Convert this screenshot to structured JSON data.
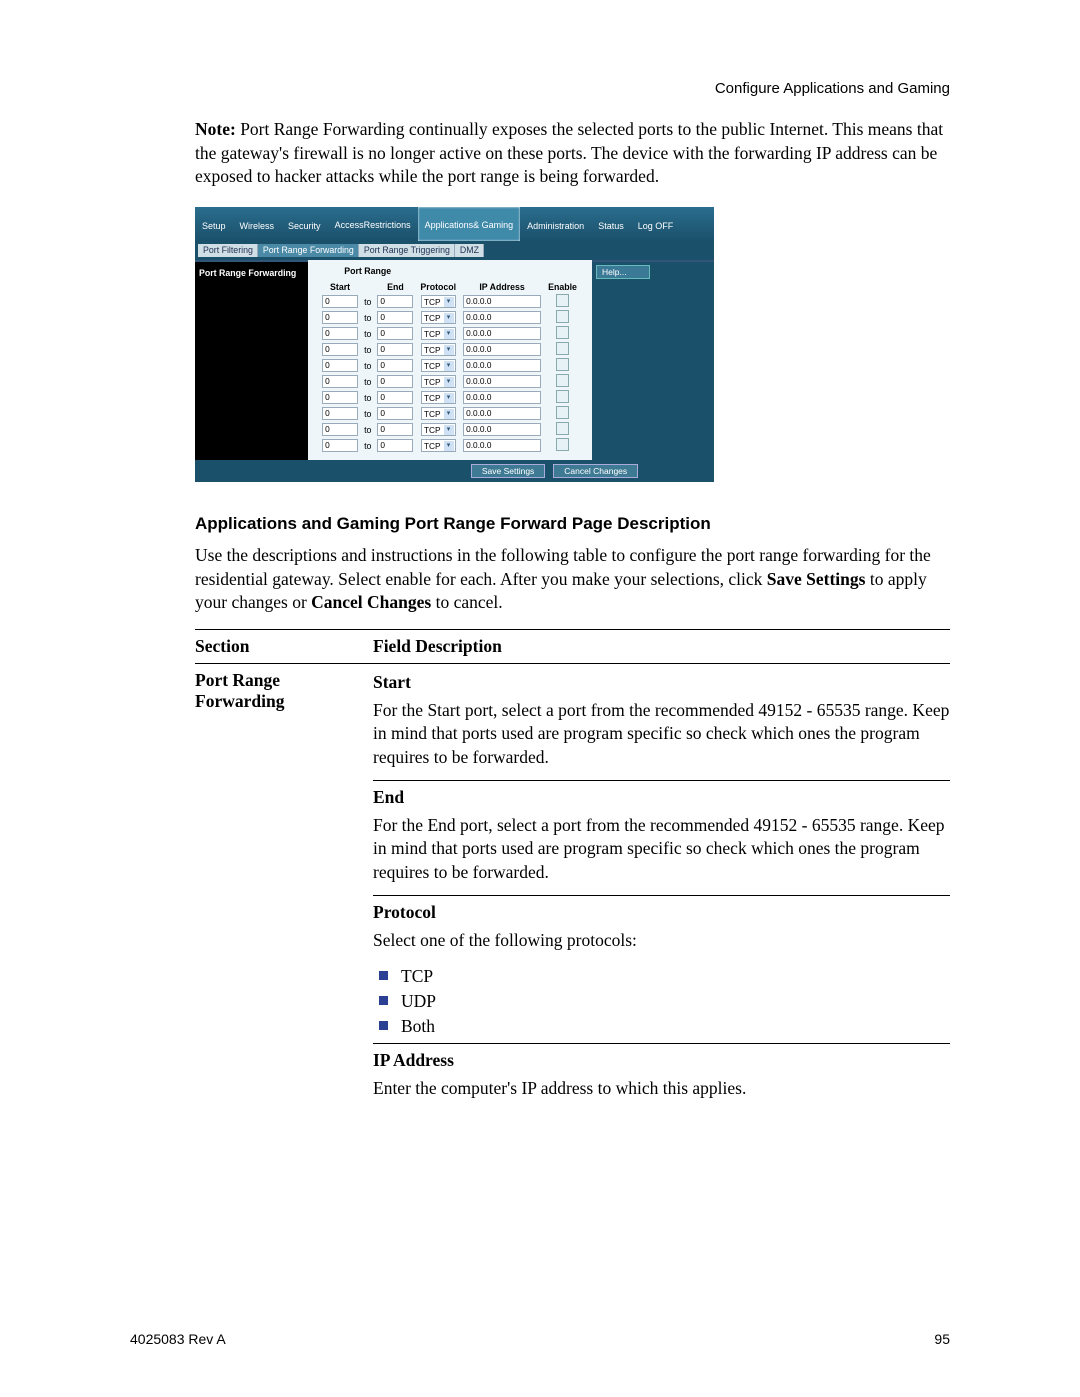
{
  "header_right": "Configure Applications and Gaming",
  "note": {
    "label": "Note:",
    "body": "Port Range Forwarding continually exposes the selected ports to the public Internet. This means that the gateway's firewall is no longer active on these ports. The device with the forwarding IP address can be exposed to hacker attacks while the port range is being forwarded."
  },
  "router_ui": {
    "tabs": [
      "Setup",
      "Wireless",
      "Security",
      "Access\nRestrictions",
      "Applications\n& Gaming",
      "Administration",
      "Status",
      "Log OFF"
    ],
    "active_tab": 4,
    "subtabs": [
      "Port Filtering",
      "Port Range Forwarding",
      "Port Range Triggering",
      "DMZ"
    ],
    "active_subtab": 1,
    "section_label": "Port Range Forwarding",
    "group_title": "Port Range",
    "columns": [
      "Start",
      "",
      "End",
      "Protocol",
      "IP Address",
      "Enable"
    ],
    "to_label": "to",
    "rows": [
      {
        "start": "0",
        "end": "0",
        "protocol": "TCP",
        "ip": "0.0.0.0",
        "enable": false
      },
      {
        "start": "0",
        "end": "0",
        "protocol": "TCP",
        "ip": "0.0.0.0",
        "enable": false
      },
      {
        "start": "0",
        "end": "0",
        "protocol": "TCP",
        "ip": "0.0.0.0",
        "enable": false
      },
      {
        "start": "0",
        "end": "0",
        "protocol": "TCP",
        "ip": "0.0.0.0",
        "enable": false
      },
      {
        "start": "0",
        "end": "0",
        "protocol": "TCP",
        "ip": "0.0.0.0",
        "enable": false
      },
      {
        "start": "0",
        "end": "0",
        "protocol": "TCP",
        "ip": "0.0.0.0",
        "enable": false
      },
      {
        "start": "0",
        "end": "0",
        "protocol": "TCP",
        "ip": "0.0.0.0",
        "enable": false
      },
      {
        "start": "0",
        "end": "0",
        "protocol": "TCP",
        "ip": "0.0.0.0",
        "enable": false
      },
      {
        "start": "0",
        "end": "0",
        "protocol": "TCP",
        "ip": "0.0.0.0",
        "enable": false
      },
      {
        "start": "0",
        "end": "0",
        "protocol": "TCP",
        "ip": "0.0.0.0",
        "enable": false
      }
    ],
    "help_label": "Help...",
    "save_label": "Save Settings",
    "cancel_label": "Cancel Changes"
  },
  "section_heading": "Applications and Gaming Port Range Forward Page Description",
  "intro": {
    "p1": "Use the descriptions and instructions in the following table to configure the port range forwarding for the residential gateway. Select enable for each. After you make your selections, click ",
    "b1": "Save Settings",
    "p2": " to apply your changes or ",
    "b2": "Cancel Changes",
    "p3": " to cancel."
  },
  "desc_table": {
    "col1": "Section",
    "col2": "Field Description",
    "section": "Port Range Forwarding",
    "fields": [
      {
        "title": "Start",
        "body": "For the Start port, select a port from the recommended 49152 - 65535 range. Keep in mind that ports used are program specific so check which ones the program requires to be forwarded."
      },
      {
        "title": "End",
        "body": "For the End port, select a port from the recommended 49152 - 65535 range. Keep in mind that ports used are program specific so check which ones the program requires to be forwarded."
      },
      {
        "title": "Protocol",
        "body": "Select one of the following protocols:",
        "list": [
          "TCP",
          "UDP",
          "Both"
        ]
      },
      {
        "title": "IP Address",
        "body": "Enter the computer's IP address to which this applies."
      }
    ]
  },
  "footer": {
    "left": "4025083 Rev A",
    "right": "95"
  }
}
